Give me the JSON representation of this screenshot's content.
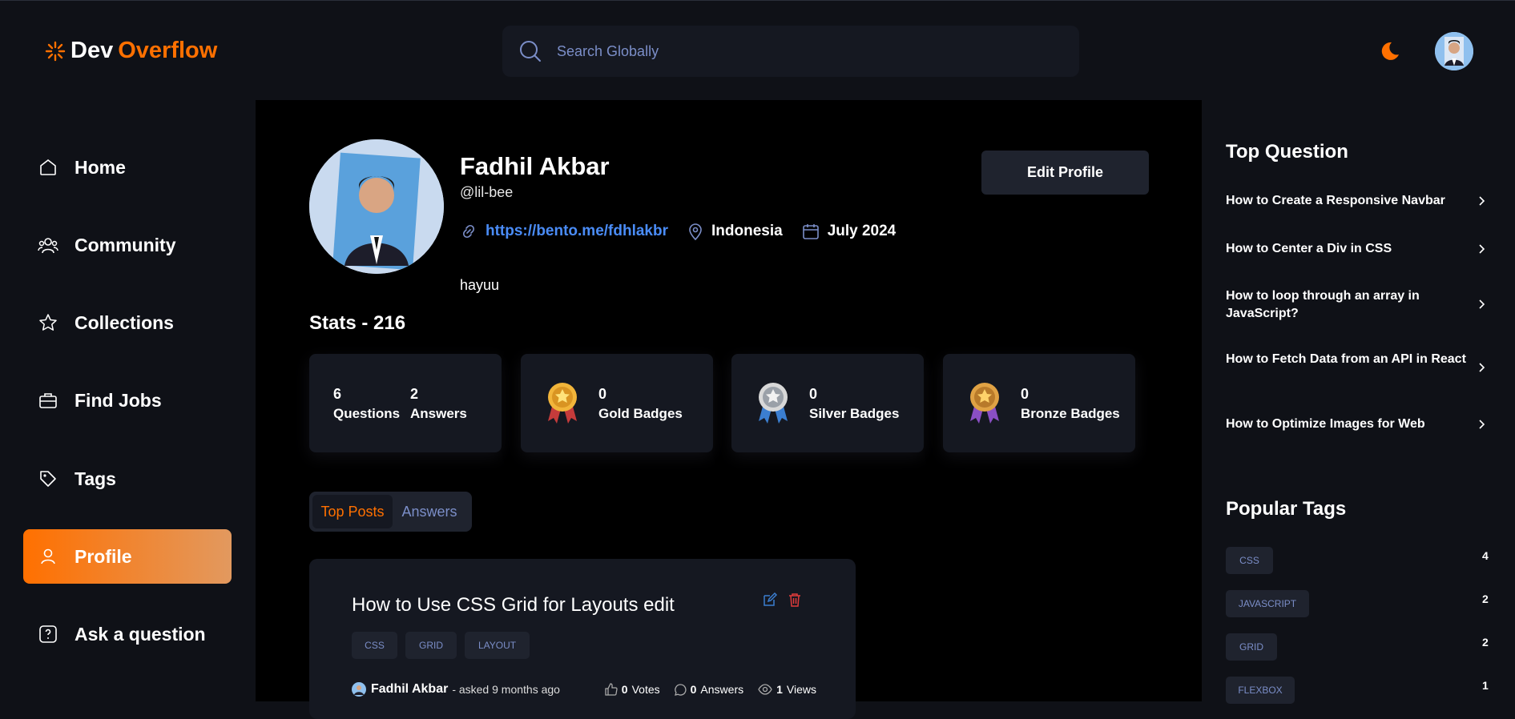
{
  "brand": {
    "part1": "Dev",
    "part2": "Overflow"
  },
  "search": {
    "placeholder": "Search Globally"
  },
  "sidebar": {
    "items": [
      {
        "label": "Home",
        "icon": "home-icon"
      },
      {
        "label": "Community",
        "icon": "users-icon"
      },
      {
        "label": "Collections",
        "icon": "star-icon"
      },
      {
        "label": "Find Jobs",
        "icon": "briefcase-icon"
      },
      {
        "label": "Tags",
        "icon": "tag-icon"
      },
      {
        "label": "Profile",
        "icon": "user-icon",
        "active": true
      },
      {
        "label": "Ask a question",
        "icon": "question-icon"
      }
    ]
  },
  "profile": {
    "name": "Fadhil Akbar",
    "handle": "@lil-bee",
    "website": "https://bento.me/fdhlakbr",
    "location": "Indonesia",
    "joined": "July 2024",
    "bio": "hayuu",
    "edit_label": "Edit Profile"
  },
  "stats": {
    "title": "Stats - 216",
    "questions": {
      "value": "6",
      "label": "Questions"
    },
    "answers": {
      "value": "2",
      "label": "Answers"
    },
    "gold": {
      "value": "0",
      "label": "Gold Badges"
    },
    "silver": {
      "value": "0",
      "label": "Silver Badges"
    },
    "bronze": {
      "value": "0",
      "label": "Bronze Badges"
    }
  },
  "tabs": {
    "top_posts": "Top Posts",
    "answers": "Answers"
  },
  "post": {
    "title": "How to Use CSS Grid for Layouts edit",
    "tags": [
      "CSS",
      "GRID",
      "LAYOUT"
    ],
    "author": "Fadhil Akbar",
    "asked": "- asked 9 months ago",
    "votes": "0",
    "votes_label": "Votes",
    "answers": "0",
    "answers_label": "Answers",
    "views": "1",
    "views_label": "Views"
  },
  "right": {
    "top_title": "Top Question",
    "questions": [
      "How to Create a Responsive Navbar",
      "How to Center a Div in CSS",
      "How to loop through an array in JavaScript?",
      "How to Fetch Data from an API in React",
      "How to Optimize Images for Web"
    ],
    "tags_title": "Popular Tags",
    "tags": [
      {
        "name": "CSS",
        "count": "4"
      },
      {
        "name": "JAVASCRIPT",
        "count": "2"
      },
      {
        "name": "GRID",
        "count": "2"
      },
      {
        "name": "FLEXBOX",
        "count": "1"
      }
    ]
  },
  "colors": {
    "accent": "#ff7000",
    "link": "#4a8cf7",
    "muted": "#7b8ec8",
    "card": "#151821"
  }
}
